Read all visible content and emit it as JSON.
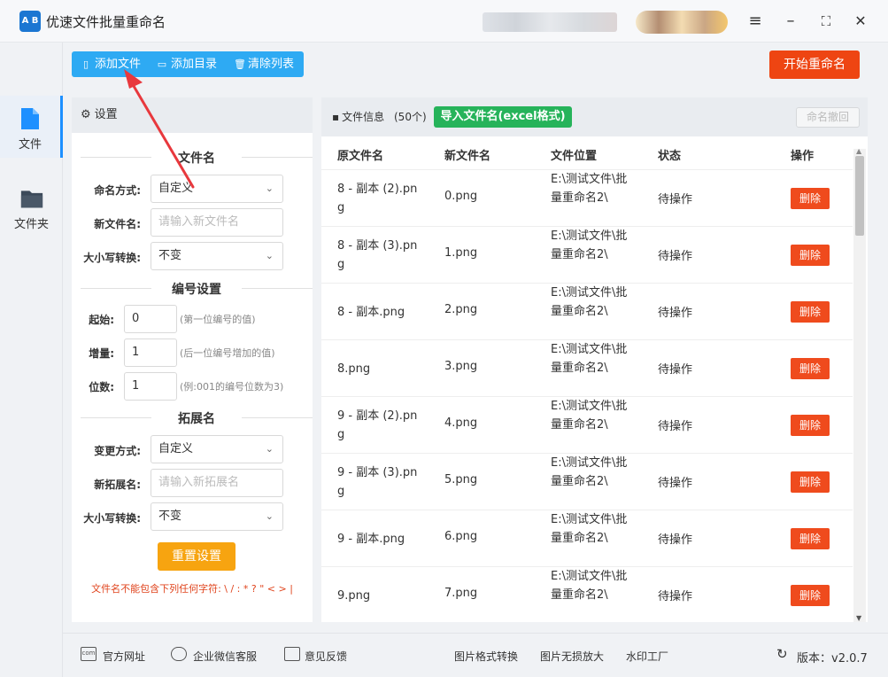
{
  "app": {
    "title": "优速文件批量重命名",
    "logo_text": "A B"
  },
  "window_controls": {
    "menu": "≡",
    "minimize": "–",
    "maximize": "⛶",
    "close": "✕"
  },
  "nav": [
    {
      "label": "文件",
      "icon": "file-icon",
      "active": true
    },
    {
      "label": "文件夹",
      "icon": "folder-icon",
      "active": false
    }
  ],
  "toolbar": {
    "add_file": "添加文件",
    "add_dir": "添加目录",
    "clear_list": "清除列表"
  },
  "start_button": "开始重命名",
  "settings": {
    "header": "设置",
    "filename_section": "文件名",
    "naming_mode_label": "命名方式:",
    "naming_mode_value": "自定义",
    "new_name_label": "新文件名:",
    "new_name_placeholder": "请输入新文件名",
    "case_label": "大小写转换:",
    "case_value": "不变",
    "number_section": "编号设置",
    "start_label": "起始:",
    "start_value": "0",
    "start_hint": "(第一位编号的值)",
    "step_label": "增量:",
    "step_value": "1",
    "step_hint": "(后一位编号增加的值)",
    "digits_label": "位数:",
    "digits_value": "1",
    "digits_hint": "(例:001的编号位数为3)",
    "ext_section": "拓展名",
    "ext_mode_label": "变更方式:",
    "ext_mode_value": "自定义",
    "new_ext_label": "新拓展名:",
    "new_ext_placeholder": "请输入新拓展名",
    "ext_case_label": "大小写转换:",
    "ext_case_value": "不变",
    "reset_button": "重置设置",
    "warning": "文件名不能包含下列任何字符: \\ / : * ? \" < > |"
  },
  "files": {
    "title": "文件信息",
    "count": "(50个)",
    "import_button": "导入文件名(excel格式)",
    "undo_button": "命名撤回",
    "columns": [
      "原文件名",
      "新文件名",
      "文件位置",
      "状态",
      "操作"
    ],
    "rows": [
      {
        "orig": "8 - 副本 (2).png",
        "new": "0.png",
        "loc": "E:\\测试文件\\批量重命名2\\",
        "status": "待操作",
        "action": "删除"
      },
      {
        "orig": "8 - 副本 (3).png",
        "new": "1.png",
        "loc": "E:\\测试文件\\批量重命名2\\",
        "status": "待操作",
        "action": "删除"
      },
      {
        "orig": "8 - 副本.png",
        "new": "2.png",
        "loc": "E:\\测试文件\\批量重命名2\\",
        "status": "待操作",
        "action": "删除"
      },
      {
        "orig": "8.png",
        "new": "3.png",
        "loc": "E:\\测试文件\\批量重命名2\\",
        "status": "待操作",
        "action": "删除"
      },
      {
        "orig": "9 - 副本 (2).png",
        "new": "4.png",
        "loc": "E:\\测试文件\\批量重命名2\\",
        "status": "待操作",
        "action": "删除"
      },
      {
        "orig": "9 - 副本 (3).png",
        "new": "5.png",
        "loc": "E:\\测试文件\\批量重命名2\\",
        "status": "待操作",
        "action": "删除"
      },
      {
        "orig": "9 - 副本.png",
        "new": "6.png",
        "loc": "E:\\测试文件\\批量重命名2\\",
        "status": "待操作",
        "action": "删除"
      },
      {
        "orig": "9.png",
        "new": "7.png",
        "loc": "E:\\测试文件\\批量重命名2\\",
        "status": "待操作",
        "action": "删除"
      }
    ]
  },
  "footer": {
    "website": "官方网址",
    "wechat": "企业微信客服",
    "feedback": "意见反馈",
    "convert": "图片格式转换",
    "enlarge": "图片无损放大",
    "watermark": "水印工厂",
    "version": "版本：v2.0.7"
  },
  "colors": {
    "toolbar": "#2eaaf3",
    "start": "#ee4512",
    "import": "#26b35a",
    "reset": "#f7a410",
    "delete": "#ef4b1d",
    "arrow": "#e8383d"
  }
}
